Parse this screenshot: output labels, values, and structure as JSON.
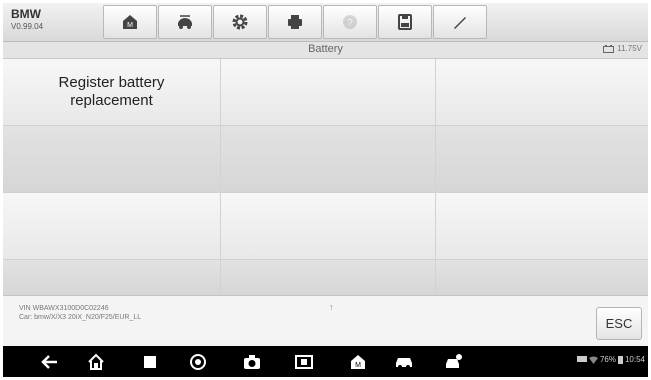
{
  "header": {
    "brand": "BMW",
    "version": "V0.99.04",
    "tools": [
      {
        "icon": "home-icon",
        "enabled": true
      },
      {
        "icon": "vehicle-swap-icon",
        "enabled": true
      },
      {
        "icon": "settings-gear-icon",
        "enabled": true
      },
      {
        "icon": "print-icon",
        "enabled": true
      },
      {
        "icon": "help-icon",
        "enabled": false
      },
      {
        "icon": "save-icon",
        "enabled": true
      },
      {
        "icon": "edit-pen-icon",
        "enabled": true
      }
    ]
  },
  "titlebar": {
    "title": "Battery",
    "voltage": "11.75V"
  },
  "grid": {
    "functions": [
      "Register battery replacement"
    ]
  },
  "footer": {
    "vin": "VIN WBAWX3100D0C02246",
    "car": "Car: bmw/X/X3 20iX_N20/F25/EUR_LL",
    "arrow": "↑",
    "esc_label": "ESC"
  },
  "android": {
    "nav_icons": [
      "back-icon",
      "home-icon",
      "recent-apps-icon",
      "browser-icon",
      "camera-icon",
      "screen-mirror-icon",
      "maxisys-home-icon",
      "car-icon",
      "car-service-icon"
    ],
    "battery": "76%",
    "time": "10:54"
  },
  "colors": {
    "toolbar_bg": "#e6e6e6",
    "nav_bg": "#000000",
    "grid_light": "#f2f2f2",
    "grid_dark": "#dcdcdc"
  }
}
